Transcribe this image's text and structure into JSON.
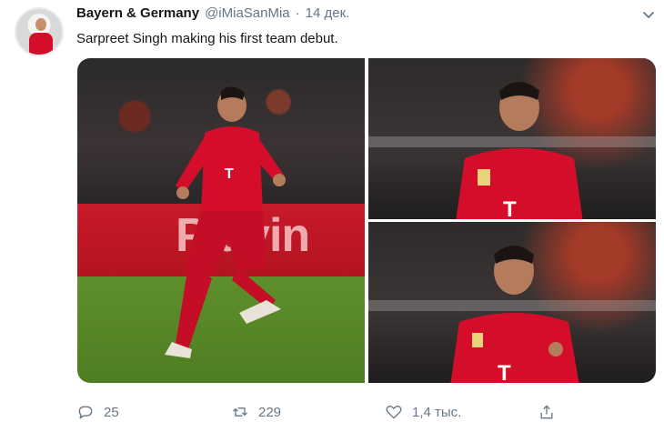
{
  "tweet": {
    "author_name": "Bayern & Germany",
    "author_handle": "@iMiaSanMia",
    "separator": "·",
    "date": "14 дек.",
    "text": "Sarpreet Singh making his first team debut."
  },
  "media": {
    "board_text": "Playin"
  },
  "actions": {
    "reply_count": "25",
    "retweet_count": "229",
    "like_count": "1,4 тыс."
  },
  "icons": {
    "reply": "reply-icon",
    "retweet": "retweet-icon",
    "like": "heart-icon",
    "share": "share-icon",
    "menu": "chevron-down-icon"
  },
  "colors": {
    "name": "#14171a",
    "secondary": "#657786",
    "kit_red": "#d40e2a"
  }
}
